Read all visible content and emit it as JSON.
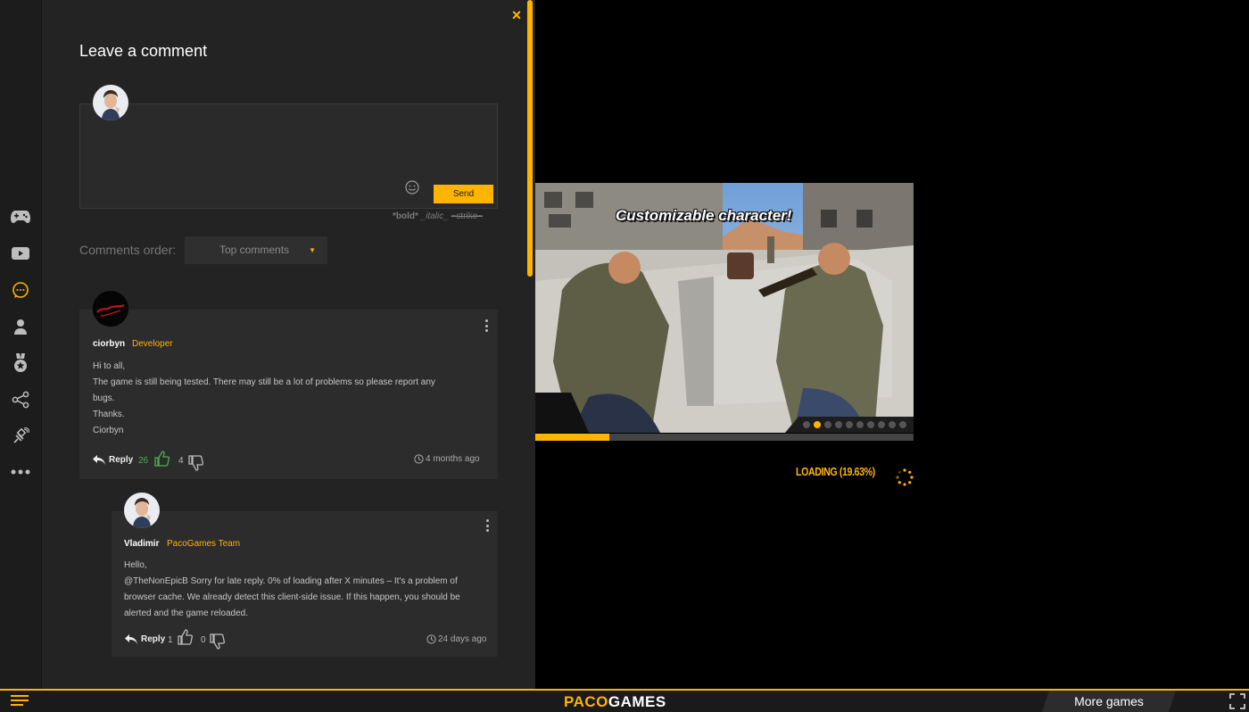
{
  "panel": {
    "title": "Leave a comment",
    "close_label": "×",
    "send_label": "Send",
    "format_bold": "*bold*",
    "format_italic": "_italic_",
    "format_strike": "~strike~",
    "order_label": "Comments order:",
    "order_value": "Top comments"
  },
  "comments": [
    {
      "author": "ciorbyn",
      "role": "Developer",
      "lines": [
        "Hi to all,",
        "The game is still being tested. There may still be a lot of problems so please report any",
        "bugs.",
        "Thanks.",
        "Ciorbyn"
      ],
      "reply_label": "Reply",
      "likes": "26",
      "dislikes": "4",
      "time": "4 months ago"
    },
    {
      "author": "Vladimir",
      "role": "PacoGames Team",
      "lines": [
        "Hello,",
        "@TheNonEpicB Sorry for late reply. 0% of loading after X minutes – It's a problem of",
        "browser cache. We already detect this client-side issue. If this happen, you should be",
        "alerted and the game reloaded."
      ],
      "reply_label": "Reply",
      "likes": "1",
      "dislikes": "0",
      "time": "24 days ago"
    }
  ],
  "game": {
    "caption": "Customizable character!",
    "loading": "LOADING (19.63%)",
    "load_progress": 0.1963,
    "slides": 10,
    "active_slide": 1
  },
  "bottom": {
    "logo_a": "PACO",
    "logo_b": "GAMES",
    "more_games": "More games"
  },
  "colors": {
    "accent": "#ffb400",
    "panel": "#232323",
    "card": "#2c2c2c",
    "like": "#4caf50"
  },
  "rail_icons": [
    "gamepad-icon",
    "youtube-icon",
    "comments-icon",
    "user-icon",
    "medal-icon",
    "share-icon",
    "satellite-icon",
    "more-icon"
  ]
}
